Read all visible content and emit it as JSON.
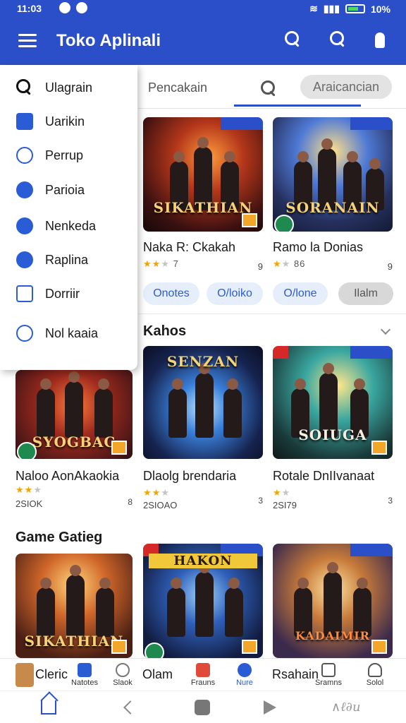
{
  "status_bar": {
    "time": "11:03",
    "battery": "10%"
  },
  "app_bar": {
    "title": "Toko Aplinali"
  },
  "tabs": {
    "first": "Pencakain",
    "active_chip": "Araicancian"
  },
  "drawer": {
    "items": [
      {
        "label": "Ulagrain",
        "icon": "search-icon"
      },
      {
        "label": "Uarikin",
        "icon": "app-icon"
      },
      {
        "label": "Perrup",
        "icon": "person-icon"
      },
      {
        "label": "Parioia",
        "icon": "settings-icon"
      },
      {
        "label": "Nenkeda",
        "icon": "circle-icon"
      },
      {
        "label": "Raplina",
        "icon": "shuffle-icon"
      },
      {
        "label": "Dorriir",
        "icon": "book-icon"
      },
      {
        "label": "Nol kaaia",
        "icon": "clock-icon"
      }
    ]
  },
  "row1": {
    "cards": [
      {
        "name": "Naka R: Ckakah",
        "logo": "SIKATHIAN",
        "rating_text": "7",
        "count": "9"
      },
      {
        "name": "Ramo la Donias",
        "logo": "SORANAIN",
        "rating_text": "86",
        "count": "9"
      }
    ],
    "pills": [
      "Onotes",
      "O/loiko",
      "O/lone",
      "Ilalm"
    ]
  },
  "section_kahos": {
    "title": "Kahos"
  },
  "row2": {
    "cards": [
      {
        "name": "Naloo AonAkaokia",
        "logo": "SYOGBAC",
        "count": "2SIOK",
        "mini": "8"
      },
      {
        "name": "Dlaolg brendaria",
        "logo": "SENZAN",
        "count": "2SIOAO",
        "mini": "3"
      },
      {
        "name": "Rotale DnIIvanaat",
        "logo": "SOIUGA",
        "count": "2SI79",
        "mini": "3"
      }
    ]
  },
  "section_game": {
    "title": "Game Gatieg"
  },
  "row3": {
    "cards": [
      {
        "logo": "SIKATHIAN"
      },
      {
        "logo": "HAKON"
      },
      {
        "logo": "KADAIMIR"
      }
    ]
  },
  "bottom_tabs": {
    "items": [
      {
        "label": "Cleric"
      },
      {
        "label": "Natotes"
      },
      {
        "label": "Slaok"
      },
      {
        "label": "Olam"
      },
      {
        "label": "Frauns"
      },
      {
        "label": "Nure"
      },
      {
        "label": "Rsahain"
      },
      {
        "label": "Sramns"
      },
      {
        "label": "Solol"
      }
    ]
  },
  "colors": {
    "brand": "#2a4fc9",
    "accent": "#2a5cd6",
    "star": "#f0a500"
  }
}
